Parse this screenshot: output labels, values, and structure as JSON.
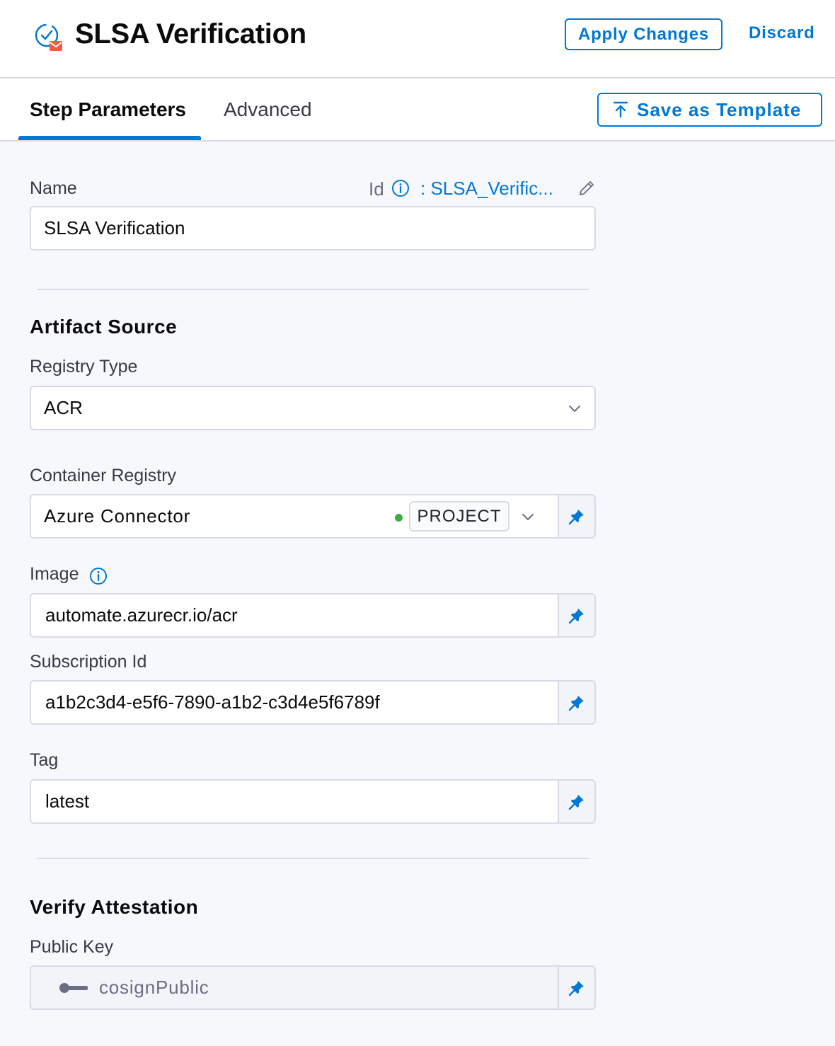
{
  "header": {
    "title": "SLSA Verification",
    "apply_label": "Apply Changes",
    "discard_label": "Discard"
  },
  "tabs": [
    {
      "label": "Step Parameters",
      "active": true
    },
    {
      "label": "Advanced",
      "active": false
    }
  ],
  "save_template_label": "Save as Template",
  "form": {
    "name_label": "Name",
    "id_label": "Id",
    "id_value": ": SLSA_Verific...",
    "name_value": "SLSA Verification",
    "artifact_source_title": "Artifact Source",
    "registry_type_label": "Registry Type",
    "registry_type_value": "ACR",
    "container_registry_label": "Container Registry",
    "container_registry_value": "Azure Connector",
    "scope_badge": "PROJECT",
    "image_label": "Image",
    "image_value": "automate.azurecr.io/acr",
    "subscription_label": "Subscription Id",
    "subscription_value": "a1b2c3d4-e5f6-7890-a1b2-c3d4e5f6789f",
    "tag_label": "Tag",
    "tag_value": "latest",
    "verify_title": "Verify Attestation",
    "public_key_label": "Public Key",
    "public_key_value": "cosignPublic"
  },
  "icons": {
    "step": "slsa-verification-icon",
    "info": "info-icon",
    "edit": "pencil-icon",
    "pin": "pin-icon",
    "chevron": "chevron-down-icon",
    "key": "key-icon",
    "upload": "upload-icon"
  },
  "colors": {
    "accent": "#0278d5",
    "status_connected": "#42ab45",
    "step_icon_accent": "#e8603c"
  }
}
